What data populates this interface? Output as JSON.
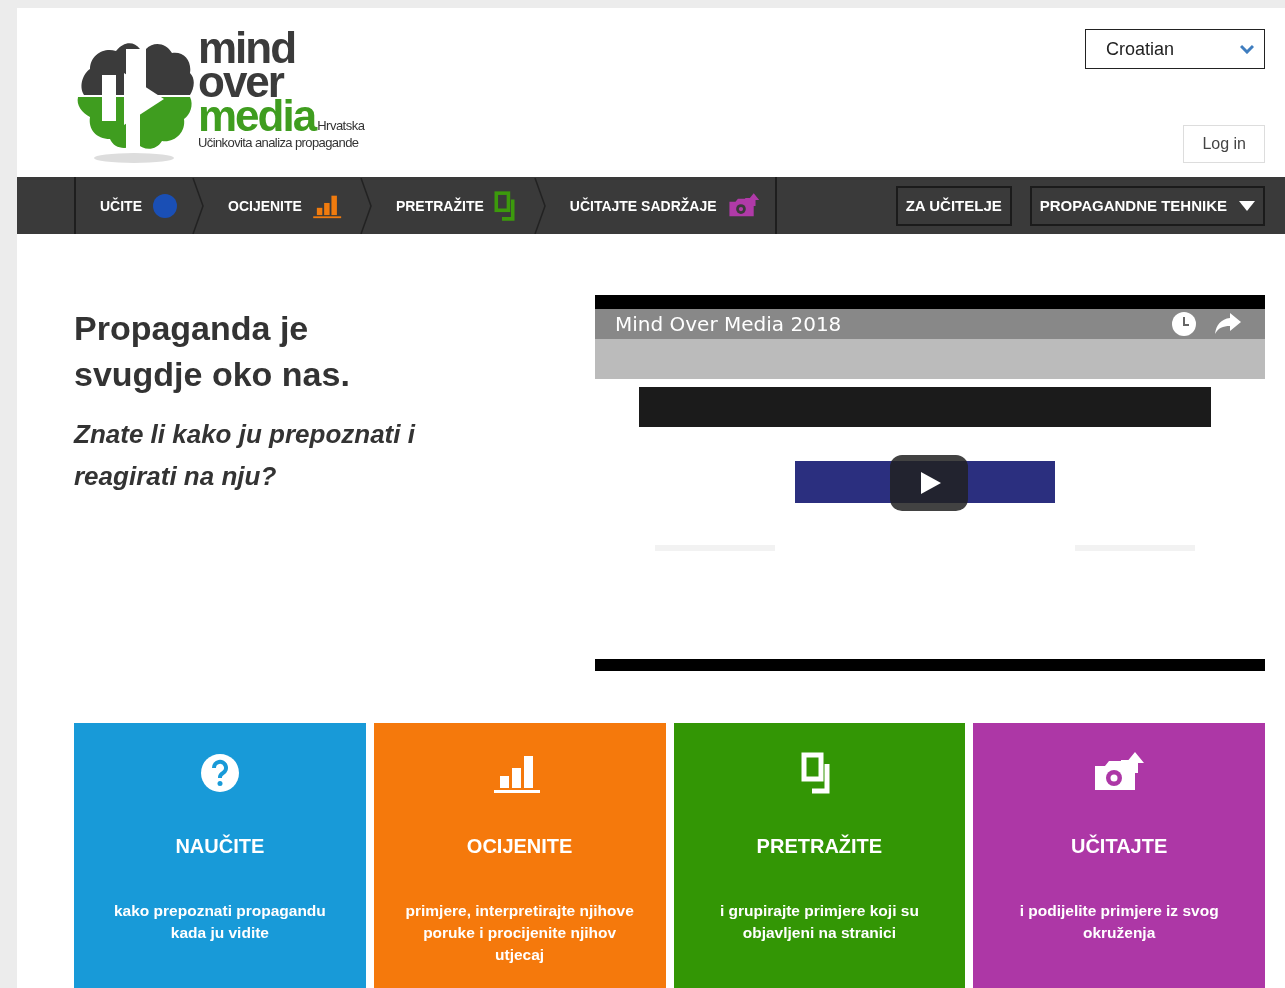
{
  "logo": {
    "line_1": "mind",
    "line_2": "over",
    "line_3": "media",
    "region": "Hrvatska",
    "tagline": "Učinkovita analiza propagande"
  },
  "language_select": {
    "value": "Croatian"
  },
  "login_button": "Log in",
  "nav": {
    "items": [
      {
        "label": "UČITE",
        "color": "#1a4fb5"
      },
      {
        "label": "OCIJENITE",
        "color": "#f07b0e"
      },
      {
        "label": "PRETRAŽITE",
        "color": "#3c9a0c"
      },
      {
        "label": "UČITAJTE SADRŽAJE",
        "color": "#b03aa8"
      }
    ],
    "buttons": [
      {
        "label": "ZA UČITELJE",
        "has_dropdown": false
      },
      {
        "label": "PROPAGANDNE TEHNIKE",
        "has_dropdown": true
      }
    ]
  },
  "hero": {
    "heading": "Propaganda je svugdje oko nas.",
    "subheading": "Znate li kako ju prepoznati i reagirati na nju?"
  },
  "video": {
    "title": "Mind Over Media 2018"
  },
  "cards": [
    {
      "title": "NAUČITE",
      "text": "kako prepoznati propagandu kada ju vidite",
      "color": "#189ad8"
    },
    {
      "title": "OCIJENITE",
      "text": "primjere, interpretirajte njihove poruke i procijenite njihov utjecaj",
      "color": "#f5790c"
    },
    {
      "title": "PRETRAŽITE",
      "text": "i grupirajte primjere koji su objavljeni na stranici",
      "color": "#339605"
    },
    {
      "title": "UČITAJTE",
      "text": "i podijelite primjere iz svog okruženja",
      "color": "#ad37a6"
    }
  ]
}
